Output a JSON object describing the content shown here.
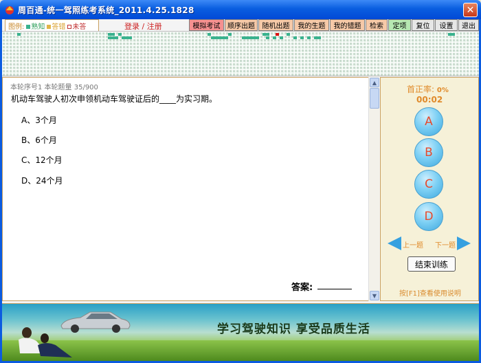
{
  "window": {
    "title": "周百通-统一驾照练考系统_2011.4.25.1828",
    "close_symbol": "✕"
  },
  "toolbar": {
    "legend": {
      "label": "图例:",
      "done": "熟知",
      "wrong": "答错",
      "todo": "未答"
    },
    "login": "登录 / 注册",
    "buttons": {
      "mock_exam": "模拟考试",
      "sequential": "顺序出题",
      "random": "随机出题",
      "my_topics": "我的生题",
      "my_wrong": "我的错题",
      "search": "检索",
      "fixed": "定项",
      "reset": "复位",
      "settings": "设置",
      "exit": "退出"
    }
  },
  "question": {
    "info": "本轮序号1 本轮题量 35/900",
    "text": "机动车驾驶人初次申领机动车驾驶证后的____为实习期。",
    "options": [
      {
        "key": "A",
        "text": "A、3个月"
      },
      {
        "key": "B",
        "text": "B、6个月"
      },
      {
        "key": "C",
        "text": "C、12个月"
      },
      {
        "key": "D",
        "text": "D、24个月"
      }
    ],
    "answer_label": "答案:"
  },
  "side": {
    "accuracy_label": "首正率:",
    "accuracy_value": "0%",
    "timer": "00:02",
    "choices": [
      "A",
      "B",
      "C",
      "D"
    ],
    "prev_label": "上一题",
    "next_label": "下一题",
    "end_button": "结束训练",
    "help": "按[F1]查看使用说明"
  },
  "banner": {
    "slogan": "学习驾驶知识  享受品质生活"
  },
  "colors": {
    "title_bar": "#0a5ee0",
    "accent_orange": "#e08a2a",
    "choice_blue": "#7ed0f4",
    "mock_exam_bg": "#f59090",
    "done_cell": "#39b28e"
  }
}
